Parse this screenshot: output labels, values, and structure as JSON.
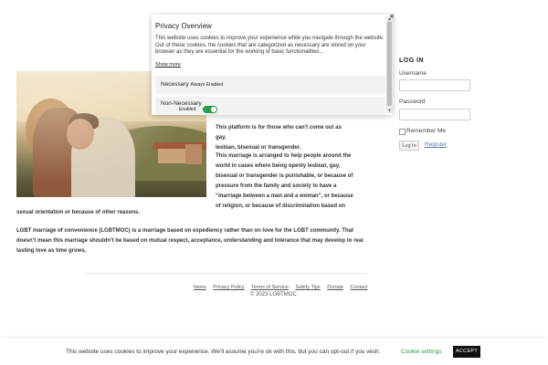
{
  "content": {
    "intro": {
      "line1": "This platform is for those who can't come out as gay,",
      "line2": "lesbian, bisexual or transgender."
    },
    "para2": {
      "line1": "This marriage is arranged to help people around the",
      "line2": "world in cases where being openly lesbian, gay,",
      "line3": "bisexual or transgender is punishable, or because of",
      "line4": "pressure from the family and society to have a",
      "line5": "“marriage between a man and a woman”, or because",
      "line6": "of religion, or because of discrimination based on",
      "line7": "sexual orientation or because of other reasons."
    },
    "para3": {
      "line1": "LGBT marriage of convenience (LGBTMOC) is a marriage based on expediency rather than on love for the LGBT community. That",
      "line2": "doesn’t mean this marriage shouldn’t be based on mutual respect, acceptance, understanding and tolerance that may develop to real",
      "line3": "lasting love as time grows."
    }
  },
  "login": {
    "title": "LOG IN",
    "username_label": "Username",
    "password_label": "Password",
    "username_value": "",
    "password_value": "",
    "remember_label": "Remember Me",
    "remember_checked": false,
    "login_button": "Log In",
    "register_link": "Register"
  },
  "footer": {
    "links": [
      "News",
      "Privacy Policy",
      "Terms of Service",
      "Safety Tips",
      "Donate",
      "Contact"
    ],
    "copyright": "© 2023 LGBTMOC"
  },
  "privacy_modal": {
    "title": "Privacy Overview",
    "text": "This website uses cookies to improve your experience while you navigate through the website. Out of these cookies, the cookies that are categorized as necessary are stored on your browser as they are essential for the working of basic functionalities...",
    "show_more": "Show more",
    "necessary_label": "Necessary",
    "necessary_status": "Always Enabled",
    "non_necessary_label": "Non-Necessary",
    "non_necessary_status": "Enabled",
    "non_necessary_enabled": true,
    "close_icon": "close-icon",
    "toggle_color": "#2a9d4a"
  },
  "cookie_bar": {
    "text": "This website uses cookies to improve your experience. We'll assume you're ok with this, but you can opt-out if you wish.",
    "settings_link": "Cookie settings",
    "accept_button": "ACCEPT"
  }
}
